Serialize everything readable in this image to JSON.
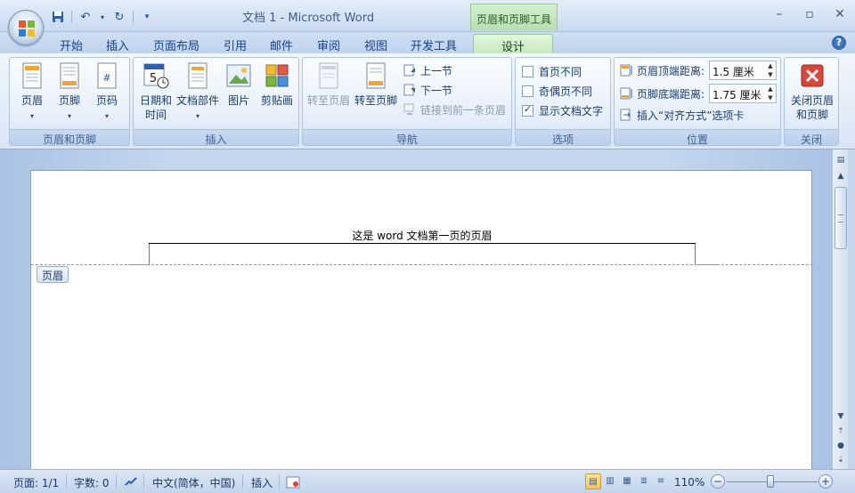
{
  "window": {
    "title": "文档 1 - Microsoft Word",
    "context_tool_title": "页眉和页脚工具",
    "controls": [
      "minimize",
      "maximize",
      "close"
    ]
  },
  "quick_access": {
    "items": [
      "save-icon",
      "undo-icon",
      "redo-icon",
      "customize-icon"
    ]
  },
  "tabs": [
    {
      "label": "开始"
    },
    {
      "label": "插入"
    },
    {
      "label": "页面布局"
    },
    {
      "label": "引用"
    },
    {
      "label": "邮件"
    },
    {
      "label": "审阅"
    },
    {
      "label": "视图"
    },
    {
      "label": "开发工具"
    },
    {
      "label": "设计",
      "active": true
    }
  ],
  "ribbon": {
    "groups": {
      "header_footer": {
        "label": "页眉和页脚",
        "buttons": [
          "页眉",
          "页脚",
          "页码"
        ]
      },
      "insert": {
        "label": "插入",
        "datetime": [
          "日期和",
          "时间"
        ],
        "parts": "文档部件",
        "picture": "图片",
        "clipart": "剪贴画"
      },
      "navigation": {
        "label": "导航",
        "goto_header": "转至页眉",
        "goto_footer": "转至页脚",
        "prev": "上一节",
        "next": "下一节",
        "link_prev": "链接到前一条页眉"
      },
      "options": {
        "label": "选项",
        "items": [
          {
            "label": "首页不同",
            "checked": false
          },
          {
            "label": "奇偶页不同",
            "checked": false
          },
          {
            "label": "显示文档文字",
            "checked": true
          }
        ]
      },
      "position": {
        "label": "位置",
        "header_top_label": "页眉顶端距离:",
        "header_top_value": "1.5 厘米",
        "footer_bottom_label": "页脚底端距离:",
        "footer_bottom_value": "1.75 厘米",
        "insert_align": "插入“对齐方式”选项卡"
      },
      "close": {
        "label": "关闭",
        "button": [
          "关闭页眉",
          "和页脚"
        ]
      }
    }
  },
  "document": {
    "header_text": "这是 word 文档第一页的页眉",
    "header_tag": "页眉"
  },
  "statusbar": {
    "page": "页面: 1/1",
    "words": "字数: 0",
    "language": "中文(简体，中国)",
    "mode": "插入",
    "zoom": "110%"
  }
}
